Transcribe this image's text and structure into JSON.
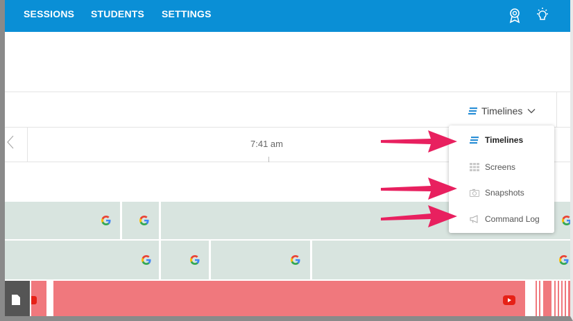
{
  "nav": {
    "items": [
      "SESSIONS",
      "STUDENTS",
      "SETTINGS"
    ],
    "icons": [
      "award-icon",
      "lightbulb-icon"
    ]
  },
  "view_selector": {
    "label": "Timelines",
    "icon": "timelines-icon"
  },
  "timeline": {
    "time_label": "7:41 am"
  },
  "menu": {
    "items": [
      {
        "label": "Timelines",
        "icon": "timelines-icon",
        "active": true
      },
      {
        "label": "Screens",
        "icon": "grid-icon",
        "active": false
      },
      {
        "label": "Snapshots",
        "icon": "camera-icon",
        "active": false
      },
      {
        "label": "Command Log",
        "icon": "megaphone-icon",
        "active": false
      }
    ]
  },
  "colors": {
    "nav_bg": "#0a8fd6",
    "accent": "#2a8fd6",
    "track_bg": "#d8e4df",
    "youtube_red": "#f0787d",
    "arrow": "#e8205f"
  }
}
